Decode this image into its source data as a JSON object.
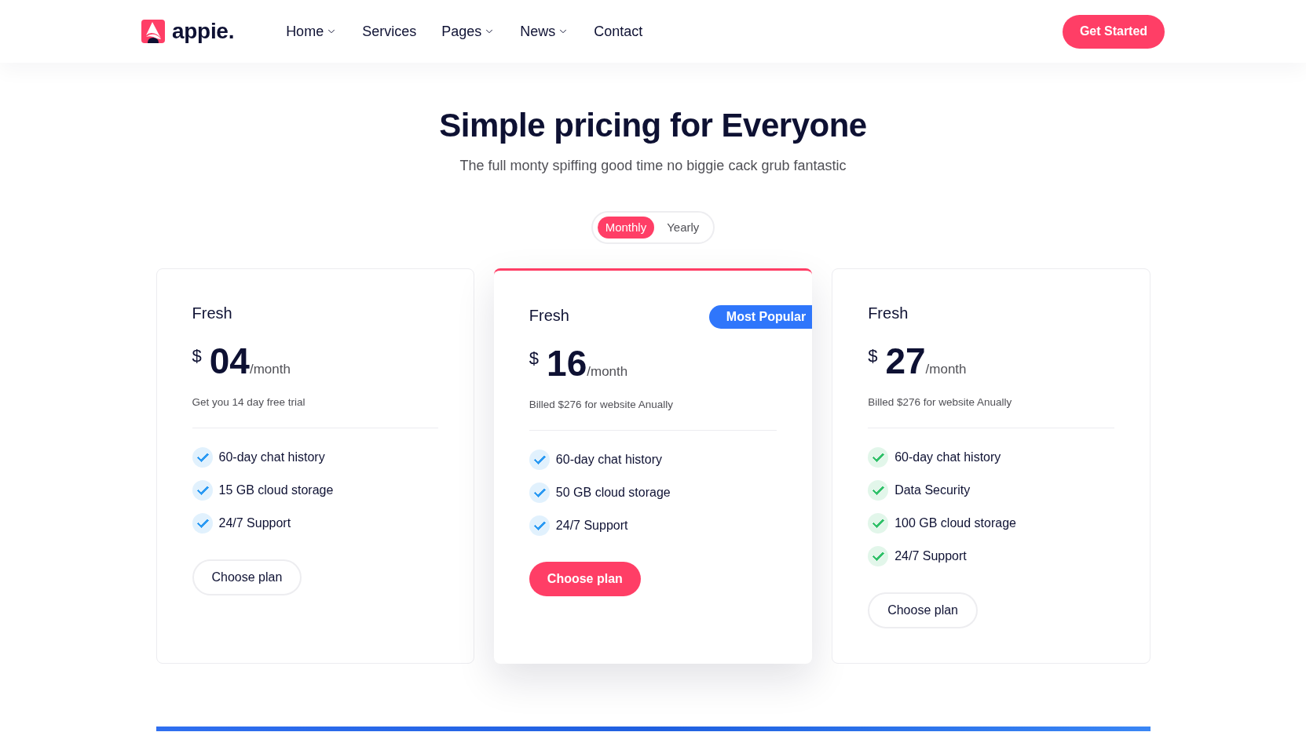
{
  "header": {
    "brand": "appie.",
    "nav": [
      {
        "label": "Home",
        "dropdown": true
      },
      {
        "label": "Services",
        "dropdown": false
      },
      {
        "label": "Pages",
        "dropdown": true
      },
      {
        "label": "News",
        "dropdown": true
      },
      {
        "label": "Contact",
        "dropdown": false
      }
    ],
    "cta": "Get Started"
  },
  "hero": {
    "title": "Simple pricing for Everyone",
    "subtitle": "The full monty spiffing good time no biggie cack grub fantastic"
  },
  "billing_toggle": [
    {
      "label": "Monthly",
      "selected": true
    },
    {
      "label": "Yearly",
      "selected": false
    }
  ],
  "plans": [
    {
      "name": "Fresh",
      "currency": "$",
      "amount": "04",
      "period": "/month",
      "note": "Get you 14 day free trial",
      "featured": false,
      "color": "#2b9af3",
      "features": [
        "60-day chat history",
        "15 GB cloud storage",
        "24/7 Support"
      ],
      "button": "Choose plan"
    },
    {
      "name": "Fresh",
      "badge": "Most Popular",
      "currency": "$",
      "amount": "16",
      "period": "/month",
      "note": "Billed $276 for website Anually",
      "featured": true,
      "color": "#2b9af3",
      "features": [
        "60-day chat history",
        "50 GB cloud storage",
        "24/7 Support"
      ],
      "button": "Choose plan"
    },
    {
      "name": "Fresh",
      "currency": "$",
      "amount": "27",
      "period": "/month",
      "note": "Billed $276 for website Anually",
      "featured": false,
      "color": "#31c16a",
      "features": [
        "60-day chat history",
        "Data Security",
        "100 GB cloud storage",
        "24/7 Support"
      ],
      "button": "Choose plan"
    }
  ]
}
